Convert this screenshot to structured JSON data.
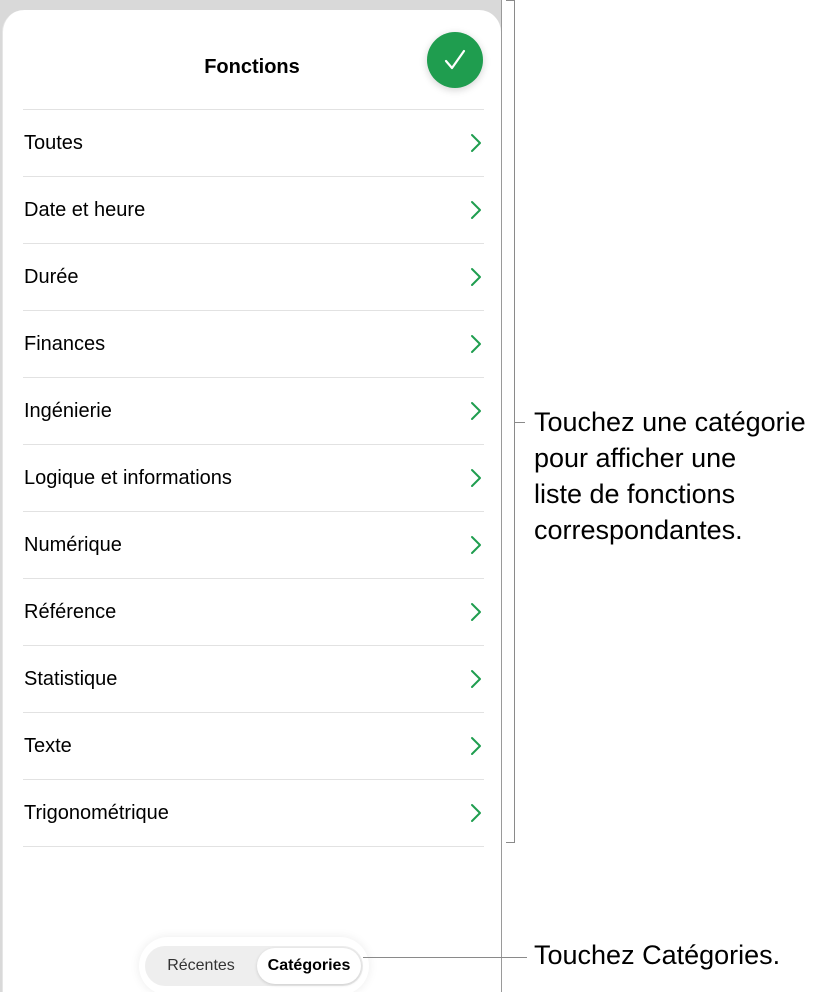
{
  "header": {
    "title": "Fonctions"
  },
  "categories": [
    {
      "label": "Toutes"
    },
    {
      "label": "Date et heure"
    },
    {
      "label": "Durée"
    },
    {
      "label": "Finances"
    },
    {
      "label": "Ingénierie"
    },
    {
      "label": "Logique et informations"
    },
    {
      "label": "Numérique"
    },
    {
      "label": "Référence"
    },
    {
      "label": "Statistique"
    },
    {
      "label": "Texte"
    },
    {
      "label": "Trigonométrique"
    }
  ],
  "segmented": {
    "recent_label": "Récentes",
    "categories_label": "Catégories",
    "selected": "Catégories"
  },
  "callouts": {
    "list_lines": [
      "Touchez une catégorie",
      "pour afficher une",
      "liste de fonctions",
      "correspondantes."
    ],
    "segment_text": "Touchez Catégories."
  },
  "colors": {
    "accent": "#1f9d4f"
  },
  "icons": {
    "done": "checkmark-icon",
    "row": "chevron-right-icon"
  }
}
